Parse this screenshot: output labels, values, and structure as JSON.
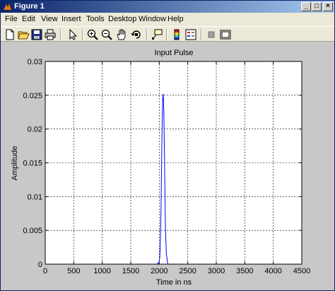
{
  "window": {
    "title": "Figure 1"
  },
  "menu": [
    "File",
    "Edit",
    "View",
    "Insert",
    "Tools",
    "Desktop",
    "Window",
    "Help"
  ],
  "toolbar": {
    "buttons": [
      "new-figure-icon",
      "open-file-icon",
      "save-icon",
      "print-icon",
      "edit-plot-arrow-icon",
      "zoom-in-icon",
      "zoom-out-icon",
      "pan-hand-icon",
      "rotate-3d-icon",
      "data-cursor-icon",
      "insert-colorbar-icon",
      "insert-legend-icon",
      "hide-plot-tools-icon",
      "show-plot-tools-icon"
    ]
  },
  "colors": {
    "line": "#0000ff",
    "titlebar": "#0a246a",
    "figure_bg": "#c8c8c8"
  },
  "chart_data": {
    "type": "line",
    "title": "Input Pulse",
    "xlabel": "Time in ns",
    "ylabel": "Amplitude",
    "xlim": [
      0,
      4500
    ],
    "ylim": [
      0,
      0.03
    ],
    "xticks": [
      0,
      500,
      1000,
      1500,
      2000,
      2500,
      3000,
      3500,
      4000,
      4500
    ],
    "yticks": [
      0,
      0.005,
      0.01,
      0.015,
      0.02,
      0.025,
      0.03
    ],
    "xtick_labels": [
      "0",
      "500",
      "1000",
      "1500",
      "2000",
      "2500",
      "3000",
      "3500",
      "4000",
      "4500"
    ],
    "ytick_labels": [
      "0",
      "0.005",
      "0.01",
      "0.015",
      "0.02",
      "0.025",
      "0.03"
    ],
    "grid": true,
    "series": [
      {
        "x": [
          0,
          1950,
          1995,
          2010,
          2020,
          2030,
          2040,
          2050,
          2060,
          2070,
          2080,
          2090,
          2100,
          2110,
          2125,
          2150,
          4500
        ],
        "y": [
          0,
          0,
          0.0002,
          0.001,
          0.0035,
          0.008,
          0.0145,
          0.0205,
          0.0245,
          0.0252,
          0.0225,
          0.017,
          0.0105,
          0.005,
          0.0015,
          0,
          0
        ]
      }
    ]
  }
}
